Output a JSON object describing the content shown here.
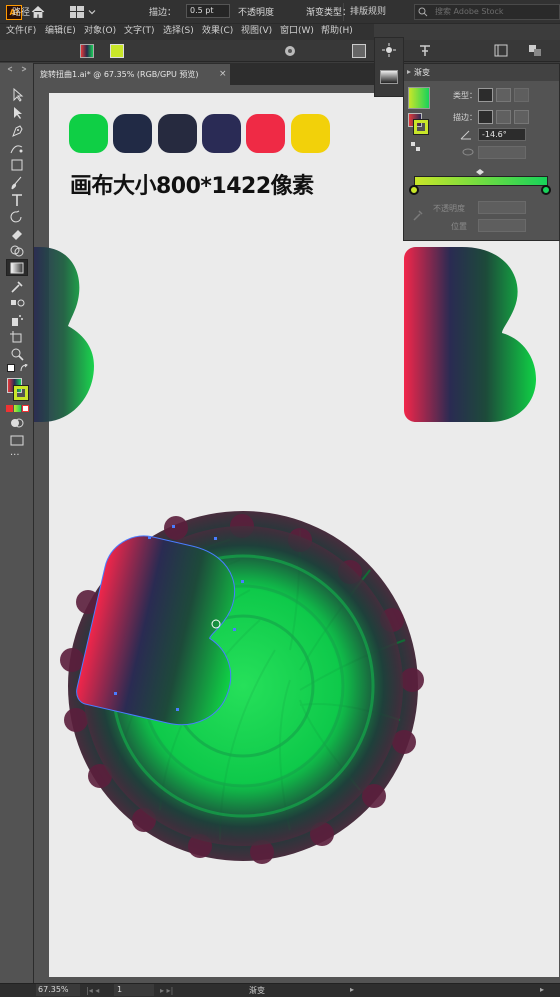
{
  "app": {
    "logo_text": "Ai",
    "workspace": "排版规则",
    "search_placeholder": "搜索 Adobe Stock"
  },
  "menu": [
    "文件(F)",
    "编辑(E)",
    "对象(O)",
    "文字(T)",
    "选择(S)",
    "效果(C)",
    "视图(V)",
    "窗口(W)",
    "帮助(H)"
  ],
  "control_bar": {
    "object_type": "路径",
    "stroke_label": "描边：",
    "stroke_value": "0.5 pt",
    "opacity_label": "不透明度",
    "gradient_type_label": "渐变类型："
  },
  "document": {
    "tab_title": "旋转扭曲1.ai* @ 67.35% (RGB/GPU 预览)",
    "close_glyph": "×"
  },
  "canvas": {
    "label": "画布大小800*1422像素",
    "palette": [
      "#0fcf45",
      "#212a45",
      "#262a3f",
      "#2a2b55",
      "#ef2a45",
      "#f2d10a"
    ]
  },
  "gradient_panel": {
    "title": "渐变",
    "type_label": "类型：",
    "stroke_label": "描边：",
    "angle_value": "-14.6°",
    "opacity_label": "不透明度",
    "location_label": "位置",
    "colors": {
      "start": "#c9e629",
      "end": "#18d25a"
    }
  },
  "status": {
    "zoom": "67.35%",
    "page": "1",
    "tool": "渐变"
  },
  "icons": [
    "home-icon",
    "search-icon",
    "selection-tool-icon",
    "direct-selection-icon",
    "pen-tool-icon",
    "curvature-tool-icon",
    "rectangle-tool-icon",
    "paintbrush-icon",
    "type-tool-icon",
    "rotate-tool-icon",
    "eraser-icon",
    "shape-builder-icon",
    "gradient-tool-icon",
    "eyedropper-icon",
    "blend-tool-icon",
    "symbol-sprayer-icon",
    "artboard-tool-icon",
    "zoom-tool-icon",
    "fill-stroke-icon",
    "more-tools-icon"
  ]
}
